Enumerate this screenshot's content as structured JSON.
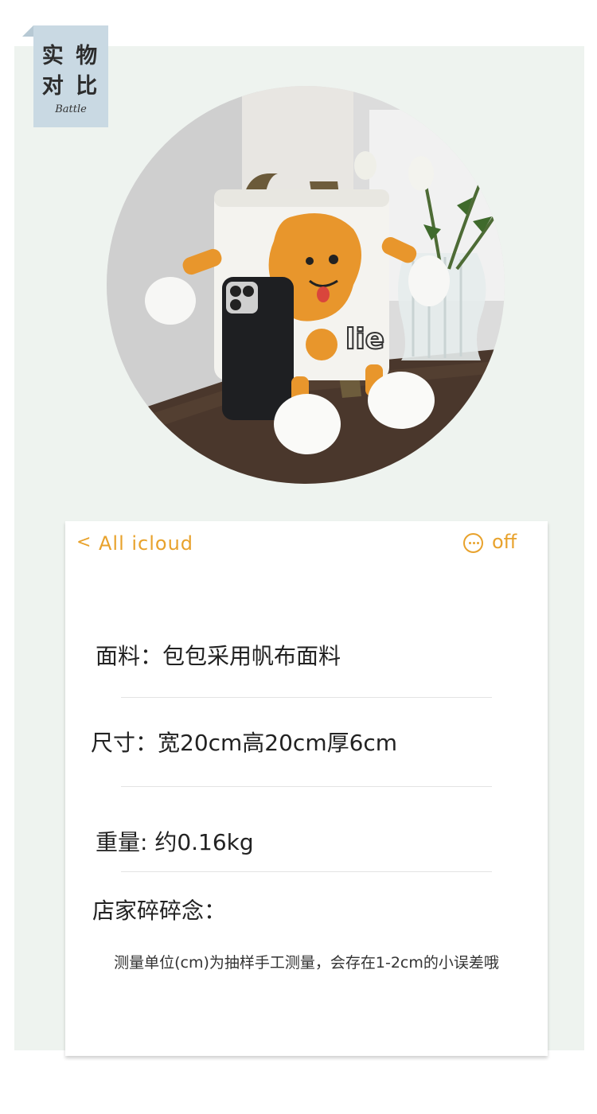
{
  "badge": {
    "line1": "实 物",
    "line2": "对 比",
    "line3": "Battle"
  },
  "nav": {
    "back_symbol": "<",
    "title": "All icloud",
    "more_icon": "ellipsis-circle-icon",
    "off_label": "off"
  },
  "specs": {
    "material": "面料：包包采用帆布面料",
    "size": "尺寸：宽20cm高20cm厚6cm",
    "weight": "重量:  约0.16kg",
    "notes_heading": "店家碎碎念：",
    "notes_text": "测量单位(cm)为抽样手工测量，会存在1-2cm的小误差哦"
  },
  "colors": {
    "accent": "#e8a22c",
    "panel_bg": "#eef3ef",
    "badge_bg": "#c9d9e3"
  }
}
